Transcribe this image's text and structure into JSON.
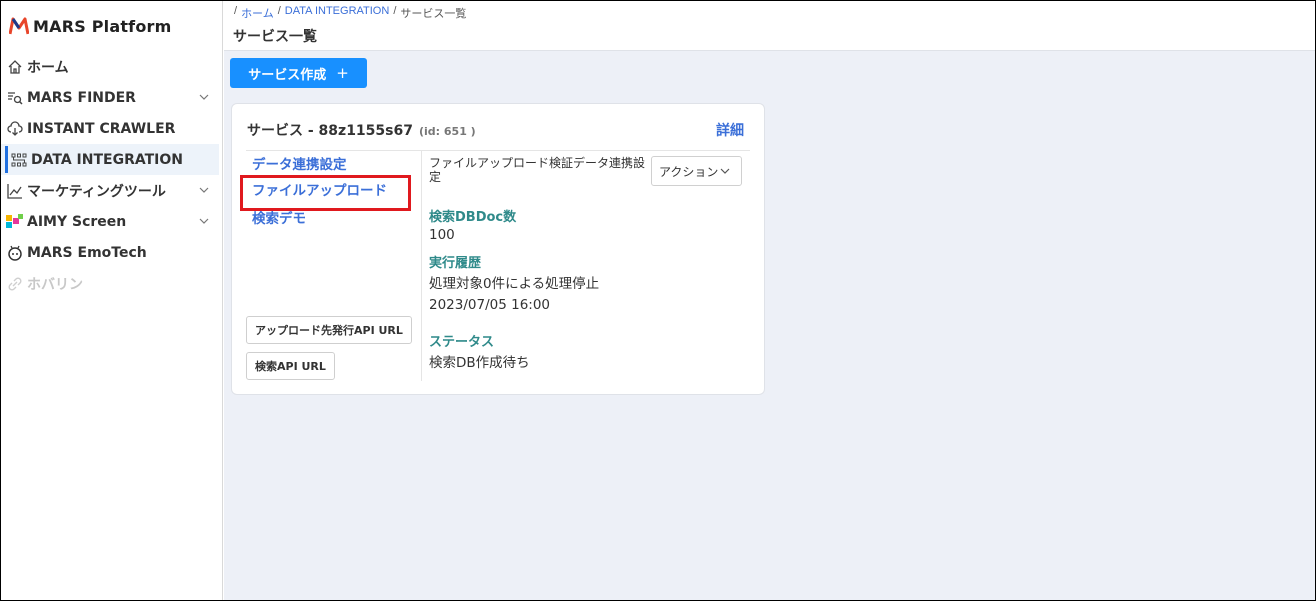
{
  "app": {
    "name": "MARS Platform"
  },
  "sidebar": {
    "items": [
      {
        "label": "ホーム",
        "icon": "home-icon"
      },
      {
        "label": "MARS FINDER",
        "icon": "search-list-icon",
        "expandable": true
      },
      {
        "label": "INSTANT CRAWLER",
        "icon": "cloud-download-icon"
      },
      {
        "label": "DATA INTEGRATION",
        "icon": "data-grid-icon",
        "active": true
      },
      {
        "label": "マーケティングツール",
        "icon": "chart-icon",
        "expandable": true
      },
      {
        "label": "AIMY Screen",
        "icon": "aimy-icon",
        "expandable": true
      },
      {
        "label": "MARS EmoTech",
        "icon": "emotech-icon"
      },
      {
        "label": "ホバリン",
        "icon": "link-icon",
        "disabled": true
      }
    ]
  },
  "breadcrumb": {
    "sep": "/",
    "home": "ホーム",
    "data_integration": "DATA INTEGRATION",
    "current": "サービス一覧"
  },
  "page": {
    "title": "サービス一覧",
    "create_button": "サービス作成",
    "create_icon": "+"
  },
  "service_card": {
    "title": "サービス - 88z1155s67",
    "id_label": "(id: 651 )",
    "detail_link": "詳細",
    "links": [
      {
        "label": "データ連携設定"
      },
      {
        "label": "ファイルアップロード",
        "highlighted": true
      },
      {
        "label": "検索デモ"
      }
    ],
    "upload_api_button": "アップロード先発行API URL",
    "search_api_button": "検索API URL",
    "upload_title": "ファイルアップロード検証データ連携設定",
    "action_select": "アクション",
    "doc_count_label": "検索DBDoc数",
    "doc_count_value": "100",
    "history_label": "実行履歴",
    "history_value": "処理対象0件による処理停止",
    "history_time": "2023/07/05 16:00",
    "status_label": "ステータス",
    "status_value": "検索DB作成待ち"
  },
  "colors": {
    "accent": "#1890ff",
    "link": "#3b6fd8",
    "label_teal": "#2f8a8a",
    "highlight_box": "#e0191e",
    "background": "#edf0f7"
  }
}
